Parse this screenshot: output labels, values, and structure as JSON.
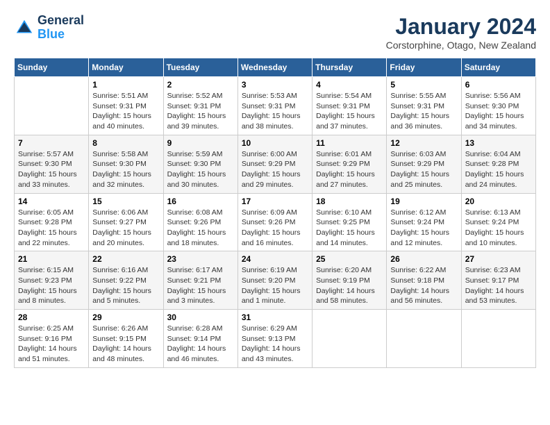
{
  "header": {
    "logo": {
      "line1": "General",
      "line2": "Blue"
    },
    "title": "January 2024",
    "location": "Corstorphine, Otago, New Zealand"
  },
  "weekdays": [
    "Sunday",
    "Monday",
    "Tuesday",
    "Wednesday",
    "Thursday",
    "Friday",
    "Saturday"
  ],
  "weeks": [
    [
      {
        "day": "",
        "info": ""
      },
      {
        "day": "1",
        "info": "Sunrise: 5:51 AM\nSunset: 9:31 PM\nDaylight: 15 hours\nand 40 minutes."
      },
      {
        "day": "2",
        "info": "Sunrise: 5:52 AM\nSunset: 9:31 PM\nDaylight: 15 hours\nand 39 minutes."
      },
      {
        "day": "3",
        "info": "Sunrise: 5:53 AM\nSunset: 9:31 PM\nDaylight: 15 hours\nand 38 minutes."
      },
      {
        "day": "4",
        "info": "Sunrise: 5:54 AM\nSunset: 9:31 PM\nDaylight: 15 hours\nand 37 minutes."
      },
      {
        "day": "5",
        "info": "Sunrise: 5:55 AM\nSunset: 9:31 PM\nDaylight: 15 hours\nand 36 minutes."
      },
      {
        "day": "6",
        "info": "Sunrise: 5:56 AM\nSunset: 9:30 PM\nDaylight: 15 hours\nand 34 minutes."
      }
    ],
    [
      {
        "day": "7",
        "info": "Sunrise: 5:57 AM\nSunset: 9:30 PM\nDaylight: 15 hours\nand 33 minutes."
      },
      {
        "day": "8",
        "info": "Sunrise: 5:58 AM\nSunset: 9:30 PM\nDaylight: 15 hours\nand 32 minutes."
      },
      {
        "day": "9",
        "info": "Sunrise: 5:59 AM\nSunset: 9:30 PM\nDaylight: 15 hours\nand 30 minutes."
      },
      {
        "day": "10",
        "info": "Sunrise: 6:00 AM\nSunset: 9:29 PM\nDaylight: 15 hours\nand 29 minutes."
      },
      {
        "day": "11",
        "info": "Sunrise: 6:01 AM\nSunset: 9:29 PM\nDaylight: 15 hours\nand 27 minutes."
      },
      {
        "day": "12",
        "info": "Sunrise: 6:03 AM\nSunset: 9:29 PM\nDaylight: 15 hours\nand 25 minutes."
      },
      {
        "day": "13",
        "info": "Sunrise: 6:04 AM\nSunset: 9:28 PM\nDaylight: 15 hours\nand 24 minutes."
      }
    ],
    [
      {
        "day": "14",
        "info": "Sunrise: 6:05 AM\nSunset: 9:28 PM\nDaylight: 15 hours\nand 22 minutes."
      },
      {
        "day": "15",
        "info": "Sunrise: 6:06 AM\nSunset: 9:27 PM\nDaylight: 15 hours\nand 20 minutes."
      },
      {
        "day": "16",
        "info": "Sunrise: 6:08 AM\nSunset: 9:26 PM\nDaylight: 15 hours\nand 18 minutes."
      },
      {
        "day": "17",
        "info": "Sunrise: 6:09 AM\nSunset: 9:26 PM\nDaylight: 15 hours\nand 16 minutes."
      },
      {
        "day": "18",
        "info": "Sunrise: 6:10 AM\nSunset: 9:25 PM\nDaylight: 15 hours\nand 14 minutes."
      },
      {
        "day": "19",
        "info": "Sunrise: 6:12 AM\nSunset: 9:24 PM\nDaylight: 15 hours\nand 12 minutes."
      },
      {
        "day": "20",
        "info": "Sunrise: 6:13 AM\nSunset: 9:24 PM\nDaylight: 15 hours\nand 10 minutes."
      }
    ],
    [
      {
        "day": "21",
        "info": "Sunrise: 6:15 AM\nSunset: 9:23 PM\nDaylight: 15 hours\nand 8 minutes."
      },
      {
        "day": "22",
        "info": "Sunrise: 6:16 AM\nSunset: 9:22 PM\nDaylight: 15 hours\nand 5 minutes."
      },
      {
        "day": "23",
        "info": "Sunrise: 6:17 AM\nSunset: 9:21 PM\nDaylight: 15 hours\nand 3 minutes."
      },
      {
        "day": "24",
        "info": "Sunrise: 6:19 AM\nSunset: 9:20 PM\nDaylight: 15 hours\nand 1 minute."
      },
      {
        "day": "25",
        "info": "Sunrise: 6:20 AM\nSunset: 9:19 PM\nDaylight: 14 hours\nand 58 minutes."
      },
      {
        "day": "26",
        "info": "Sunrise: 6:22 AM\nSunset: 9:18 PM\nDaylight: 14 hours\nand 56 minutes."
      },
      {
        "day": "27",
        "info": "Sunrise: 6:23 AM\nSunset: 9:17 PM\nDaylight: 14 hours\nand 53 minutes."
      }
    ],
    [
      {
        "day": "28",
        "info": "Sunrise: 6:25 AM\nSunset: 9:16 PM\nDaylight: 14 hours\nand 51 minutes."
      },
      {
        "day": "29",
        "info": "Sunrise: 6:26 AM\nSunset: 9:15 PM\nDaylight: 14 hours\nand 48 minutes."
      },
      {
        "day": "30",
        "info": "Sunrise: 6:28 AM\nSunset: 9:14 PM\nDaylight: 14 hours\nand 46 minutes."
      },
      {
        "day": "31",
        "info": "Sunrise: 6:29 AM\nSunset: 9:13 PM\nDaylight: 14 hours\nand 43 minutes."
      },
      {
        "day": "",
        "info": ""
      },
      {
        "day": "",
        "info": ""
      },
      {
        "day": "",
        "info": ""
      }
    ]
  ]
}
